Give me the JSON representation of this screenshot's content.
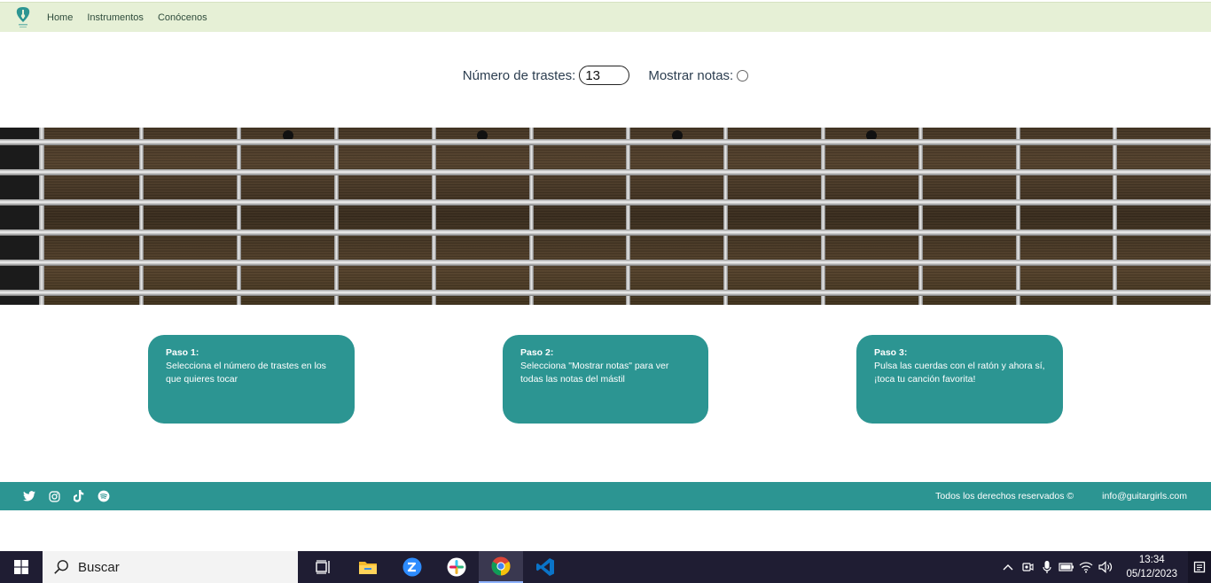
{
  "nav": {
    "logo_icon": "guitar-pick-logo-icon",
    "links": [
      "Home",
      "Instrumentos",
      "Conócenos"
    ]
  },
  "controls": {
    "frets_label": "Número de trastes:",
    "frets_value": "13",
    "notes_label": "Mostrar notas:"
  },
  "fretboard": {
    "frets": 13,
    "strings": 6,
    "inlay_frets": [
      3,
      5,
      7,
      9
    ],
    "colors": {
      "wood": "#4a3a27",
      "nut_area": "#1b1b1b",
      "string": "#e0e0e0"
    }
  },
  "steps": [
    {
      "title": "Paso 1:",
      "text": "Selecciona el número de trastes en los que quieres tocar"
    },
    {
      "title": "Paso 2:",
      "text": "Selecciona \"Mostrar notas\" para ver todas las notas del mástil"
    },
    {
      "title": "Paso 3:",
      "text": "Pulsa las cuerdas con el ratón y ahora sí, ¡toca tu canción favorita!"
    }
  ],
  "footer": {
    "social_icons": [
      "twitter-icon",
      "instagram-icon",
      "tiktok-icon",
      "spotify-icon"
    ],
    "rights": "Todos los derechos reservados ©",
    "email": "info@guitargirls.com"
  },
  "taskbar": {
    "search_placeholder": "Buscar",
    "apps": [
      "task-view-icon",
      "file-explorer-icon",
      "zoom-icon",
      "slack-icon",
      "chrome-icon",
      "vscode-icon"
    ],
    "time": "13:34",
    "date": "05/12/2023"
  },
  "colors": {
    "nav_bg": "#e6f0d6",
    "accent": "#2c9592",
    "taskbar_bg": "#1f1d33"
  }
}
